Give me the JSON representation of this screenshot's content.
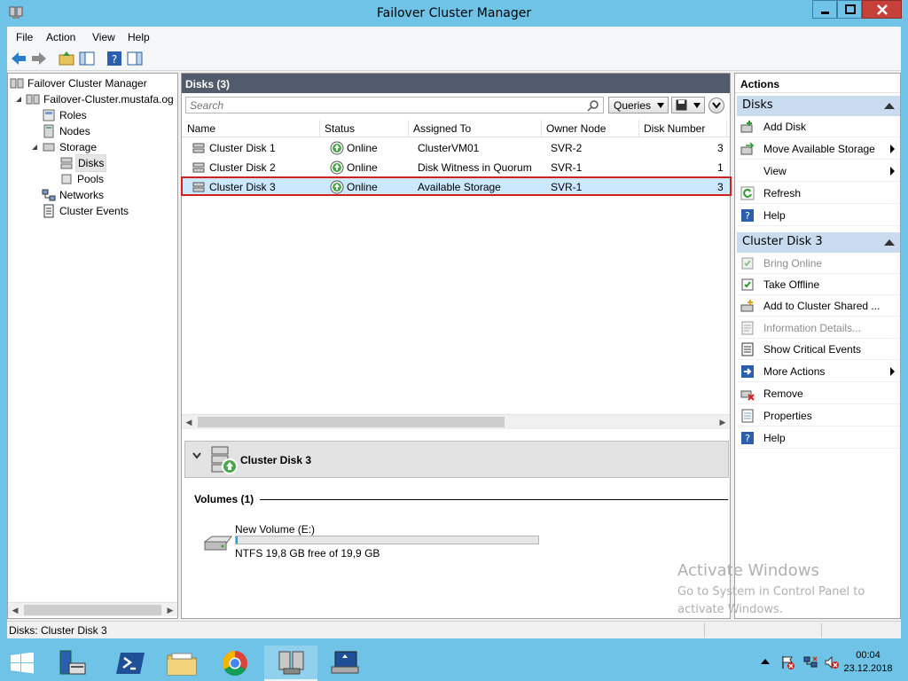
{
  "window": {
    "title": "Failover Cluster Manager"
  },
  "menu": [
    "File",
    "Action",
    "View",
    "Help"
  ],
  "tree": {
    "root": "Failover Cluster Manager",
    "cluster": "Failover-Cluster.mustafa.og",
    "roles": "Roles",
    "nodes": "Nodes",
    "storage": "Storage",
    "disks": "Disks",
    "pools": "Pools",
    "networks": "Networks",
    "events": "Cluster Events"
  },
  "center": {
    "header": "Disks (3)",
    "search_placeholder": "Search",
    "queries_label": "Queries",
    "columns": [
      "Name",
      "Status",
      "Assigned To",
      "Owner Node",
      "Disk Number"
    ],
    "rows": [
      {
        "name": "Cluster Disk 1",
        "status": "Online",
        "assigned": "ClusterVM01",
        "owner": "SVR-2",
        "number": "3"
      },
      {
        "name": "Cluster Disk 2",
        "status": "Online",
        "assigned": "Disk Witness in Quorum",
        "owner": "SVR-1",
        "number": "1"
      },
      {
        "name": "Cluster Disk 3",
        "status": "Online",
        "assigned": "Available Storage",
        "owner": "SVR-1",
        "number": "3"
      }
    ],
    "selected_row": 2,
    "detail": {
      "title": "Cluster Disk 3",
      "volumes_label": "Volumes (1)",
      "volume_name": "New Volume (E:)",
      "volume_free": "NTFS 19,8 GB free of 19,9 GB",
      "volume_used_fraction": 0.005
    }
  },
  "actions": {
    "header": "Actions",
    "sections": [
      {
        "title": "Disks",
        "items": [
          {
            "label": "Add Disk",
            "icon": "add-disk-icon",
            "submenu": false,
            "disabled": false
          },
          {
            "label": "Move Available Storage",
            "icon": "move-storage-icon",
            "submenu": true,
            "disabled": false
          },
          {
            "label": "View",
            "icon": "",
            "submenu": true,
            "disabled": false
          },
          {
            "label": "Refresh",
            "icon": "refresh-icon",
            "submenu": false,
            "disabled": false
          },
          {
            "label": "Help",
            "icon": "help-icon",
            "submenu": false,
            "disabled": false
          }
        ]
      },
      {
        "title": "Cluster Disk 3",
        "items": [
          {
            "label": "Bring Online",
            "icon": "bring-online-icon",
            "submenu": false,
            "disabled": true
          },
          {
            "label": "Take Offline",
            "icon": "take-offline-icon",
            "submenu": false,
            "disabled": false
          },
          {
            "label": "Add to Cluster Shared ...",
            "icon": "add-shared-icon",
            "submenu": false,
            "disabled": false
          },
          {
            "label": "Information Details...",
            "icon": "info-details-icon",
            "submenu": false,
            "disabled": true
          },
          {
            "label": "Show Critical Events",
            "icon": "critical-events-icon",
            "submenu": false,
            "disabled": false
          },
          {
            "label": "More Actions",
            "icon": "more-actions-icon",
            "submenu": true,
            "disabled": false
          },
          {
            "label": "Remove",
            "icon": "remove-icon",
            "submenu": false,
            "disabled": false
          },
          {
            "label": "Properties",
            "icon": "properties-icon",
            "submenu": false,
            "disabled": false
          },
          {
            "label": "Help",
            "icon": "help-icon",
            "submenu": false,
            "disabled": false
          }
        ]
      }
    ]
  },
  "status_bar": "Disks:  Cluster Disk 3",
  "watermark": {
    "line1": "Activate Windows",
    "line2": "Go to System in Control Panel to",
    "line3": "activate Windows."
  },
  "clock": {
    "time": "00:04",
    "date": "23.12.2018"
  },
  "colors": {
    "accent": "#6fc3e7",
    "header": "#525b6b",
    "section": "#c9dbee",
    "selection_border": "#d0211c"
  }
}
